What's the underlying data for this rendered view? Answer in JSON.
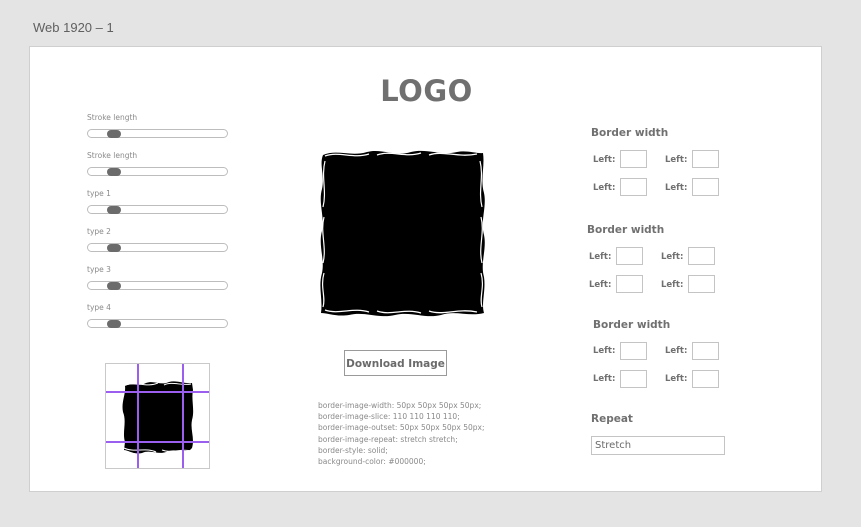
{
  "artboard": {
    "title": "Web 1920 – 1"
  },
  "logo": {
    "text": "LOGO"
  },
  "sliders": [
    {
      "label": "Stroke length",
      "value": 0.15
    },
    {
      "label": "Stroke length",
      "value": 0.15
    },
    {
      "label": "type 1",
      "value": 0.15
    },
    {
      "label": "type 2",
      "value": 0.15
    },
    {
      "label": "type 3",
      "value": 0.15
    },
    {
      "label": "type 4",
      "value": 0.15
    }
  ],
  "preview": {
    "guide_color": "#9b5ff0"
  },
  "download": {
    "label": "Download Image"
  },
  "css_output": [
    "border-image-width: 50px 50px 50px 50px;",
    "border-image-slice: 110 110 110 110;",
    "border-image-outset: 50px 50px 50px 50px;",
    "border-image-repeat: stretch stretch;",
    "border-style: solid;",
    "background-color: #000000;"
  ],
  "groups": [
    {
      "title": "Border width",
      "fields": [
        {
          "label": "Left:",
          "value": ""
        },
        {
          "label": "Left:",
          "value": ""
        },
        {
          "label": "Left:",
          "value": ""
        },
        {
          "label": "Left:",
          "value": ""
        }
      ]
    },
    {
      "title": "Border width",
      "fields": [
        {
          "label": "Left:",
          "value": ""
        },
        {
          "label": "Left:",
          "value": ""
        },
        {
          "label": "Left:",
          "value": ""
        },
        {
          "label": "Left:",
          "value": ""
        }
      ]
    },
    {
      "title": "Border width",
      "fields": [
        {
          "label": "Left:",
          "value": ""
        },
        {
          "label": "Left:",
          "value": ""
        },
        {
          "label": "Left:",
          "value": ""
        },
        {
          "label": "Left:",
          "value": ""
        }
      ]
    }
  ],
  "repeat": {
    "title": "Repeat",
    "value": "Stretch"
  }
}
